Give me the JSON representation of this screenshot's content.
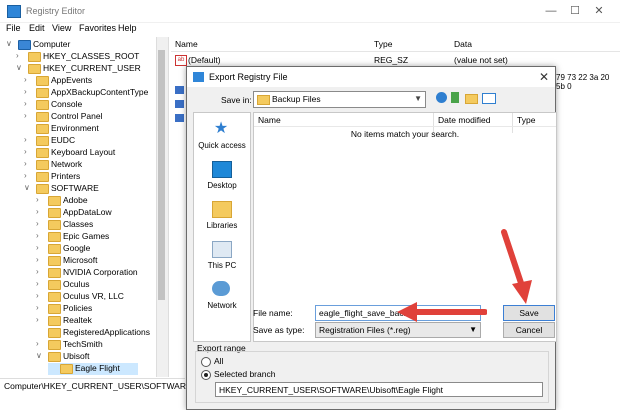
{
  "app": {
    "title": "Registry Editor",
    "window_buttons": [
      "—",
      "☐",
      "✕"
    ]
  },
  "menu": [
    "File",
    "Edit",
    "View",
    "Favorites",
    "Help"
  ],
  "tree": {
    "items": [
      {
        "label": "Computer",
        "exp": "∨",
        "level": 0
      },
      {
        "label": "HKEY_CLASSES_ROOT",
        "exp": "›",
        "level": 1
      },
      {
        "label": "HKEY_CURRENT_USER",
        "exp": "∨",
        "level": 1
      },
      {
        "label": "AppEvents",
        "exp": "›",
        "level": 2
      },
      {
        "label": "AppXBackupContentType",
        "exp": "›",
        "level": 2
      },
      {
        "label": "Console",
        "exp": "›",
        "level": 2
      },
      {
        "label": "Control Panel",
        "exp": "›",
        "level": 2
      },
      {
        "label": "Environment",
        "exp": "",
        "level": 2
      },
      {
        "label": "EUDC",
        "exp": "›",
        "level": 2
      },
      {
        "label": "Keyboard Layout",
        "exp": "›",
        "level": 2
      },
      {
        "label": "Network",
        "exp": "›",
        "level": 2
      },
      {
        "label": "Printers",
        "exp": "›",
        "level": 2
      },
      {
        "label": "SOFTWARE",
        "exp": "∨",
        "level": 2
      },
      {
        "label": "Adobe",
        "exp": "›",
        "level": 3
      },
      {
        "label": "AppDataLow",
        "exp": "›",
        "level": 3
      },
      {
        "label": "Classes",
        "exp": "›",
        "level": 3
      },
      {
        "label": "Epic Games",
        "exp": "›",
        "level": 3
      },
      {
        "label": "Google",
        "exp": "›",
        "level": 3
      },
      {
        "label": "Microsoft",
        "exp": "›",
        "level": 3
      },
      {
        "label": "NVIDIA Corporation",
        "exp": "›",
        "level": 3
      },
      {
        "label": "Oculus",
        "exp": "›",
        "level": 3
      },
      {
        "label": "Oculus VR, LLC",
        "exp": "›",
        "level": 3
      },
      {
        "label": "Policies",
        "exp": "›",
        "level": 3
      },
      {
        "label": "Realtek",
        "exp": "›",
        "level": 3
      },
      {
        "label": "RegisteredApplications",
        "exp": "",
        "level": 3
      },
      {
        "label": "TechSmith",
        "exp": "›",
        "level": 3
      },
      {
        "label": "Ubisoft",
        "exp": "∨",
        "level": 3
      },
      {
        "label": "Eagle Flight",
        "exp": "",
        "level": 4
      }
    ]
  },
  "values": {
    "headers": {
      "name": "Name",
      "type": "Type",
      "data": "Data"
    },
    "row": {
      "name": "(Default)",
      "type": "REG_SZ",
      "data": "(value not set)"
    },
    "partial_data": "79 73 22 3a 20 5b 0"
  },
  "status_path": "Computer\\HKEY_CURRENT_USER\\SOFTWARE\\Ubisof",
  "dialog": {
    "title": "Export Registry File",
    "close": "✕",
    "save_in_label": "Save in:",
    "save_in_value": "Backup Files",
    "places": [
      "Quick access",
      "Desktop",
      "Libraries",
      "This PC",
      "Network"
    ],
    "columns": {
      "name": "Name",
      "date": "Date modified",
      "type": "Type"
    },
    "empty_message": "No items match your search.",
    "file_name_label": "File name:",
    "file_name_value": "eagle_flight_save_backup",
    "save_as_type_label": "Save as type:",
    "save_as_type_value": "Registration Files (*.reg)",
    "save_button": "Save",
    "cancel_button": "Cancel",
    "export_range_label": "Export range",
    "radio_all": "All",
    "radio_selected": "Selected branch",
    "branch_value": "HKEY_CURRENT_USER\\SOFTWARE\\Ubisoft\\Eagle Flight"
  },
  "colors": {
    "arrow": "#e0413a",
    "accent": "#3c7fd4",
    "folder": "#f4ca5e"
  }
}
